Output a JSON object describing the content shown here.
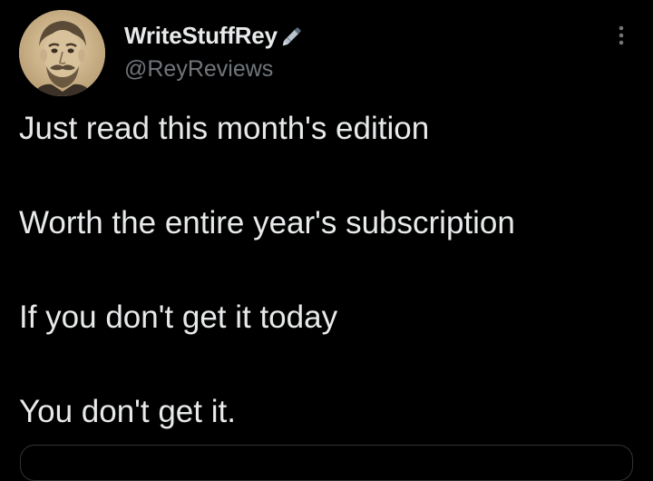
{
  "tweet": {
    "display_name": "WriteStuffRey",
    "name_emoji": "pen-icon",
    "handle": "@ReyReviews",
    "text_lines": [
      "Just read this month's edition",
      "Worth the entire year's subscription",
      "If you don't get it today",
      "You don't get it."
    ]
  },
  "colors": {
    "background": "#000000",
    "primary_text": "#e7e9ea",
    "secondary_text": "#71767b",
    "border": "#2f3336"
  },
  "icons": {
    "more": "more-vertical-icon",
    "avatar": "avatar"
  }
}
